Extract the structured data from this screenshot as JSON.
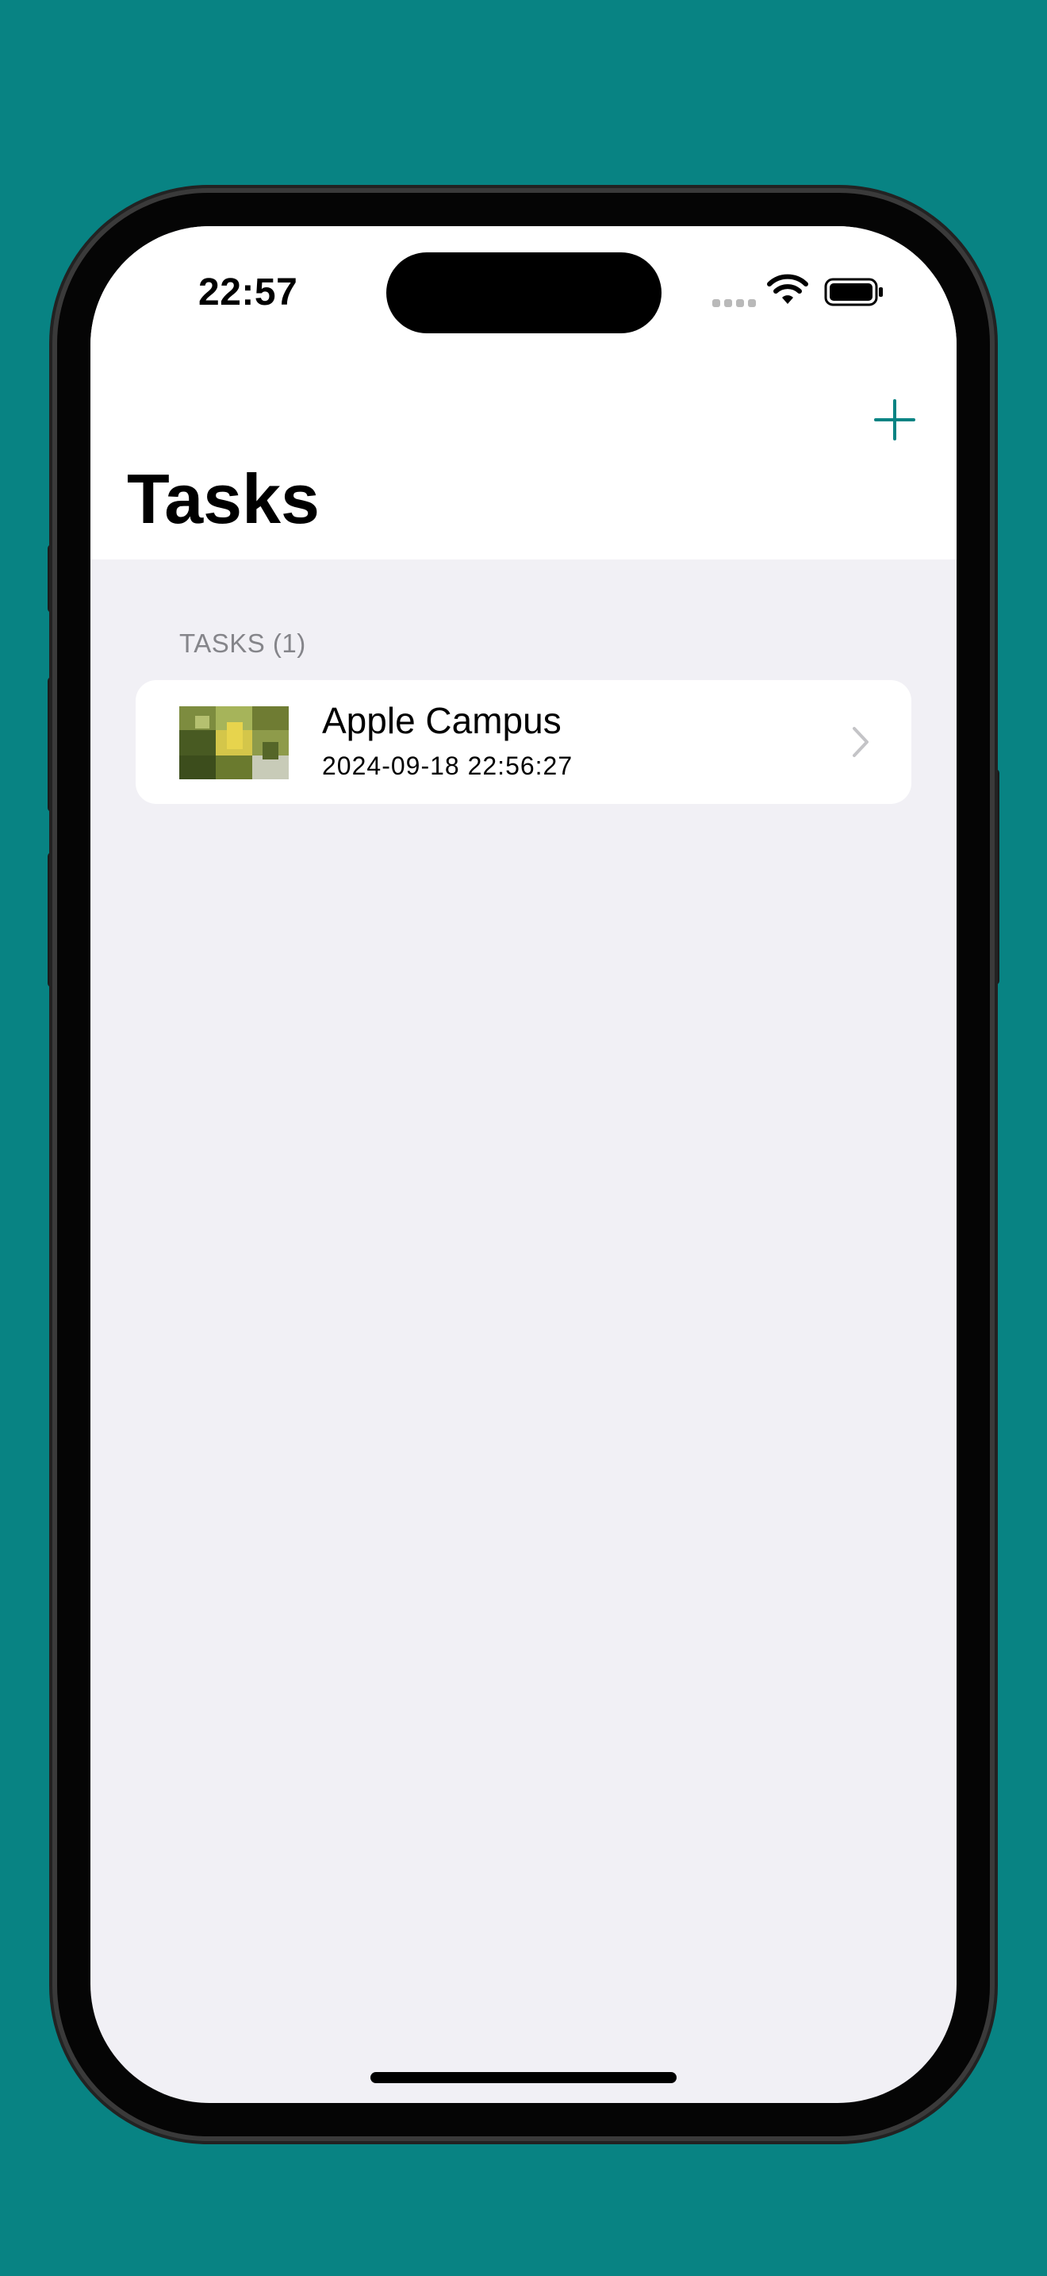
{
  "status_bar": {
    "time": "22:57",
    "icons": [
      "signal-dots-icon",
      "wifi-icon",
      "battery-icon"
    ]
  },
  "nav": {
    "add_icon": "plus-icon",
    "title": "Tasks"
  },
  "list": {
    "section_header": "TASKS (1)",
    "items": [
      {
        "title": "Apple Campus",
        "date": "2024-09-18 22:56:27",
        "thumbnail": "photo-thumbnail",
        "accessory_icon": "chevron-right-icon"
      }
    ]
  },
  "colors": {
    "background": "#088383",
    "accent": "#088383",
    "list_background": "#f1f0f5",
    "secondary_text": "#85858a"
  }
}
